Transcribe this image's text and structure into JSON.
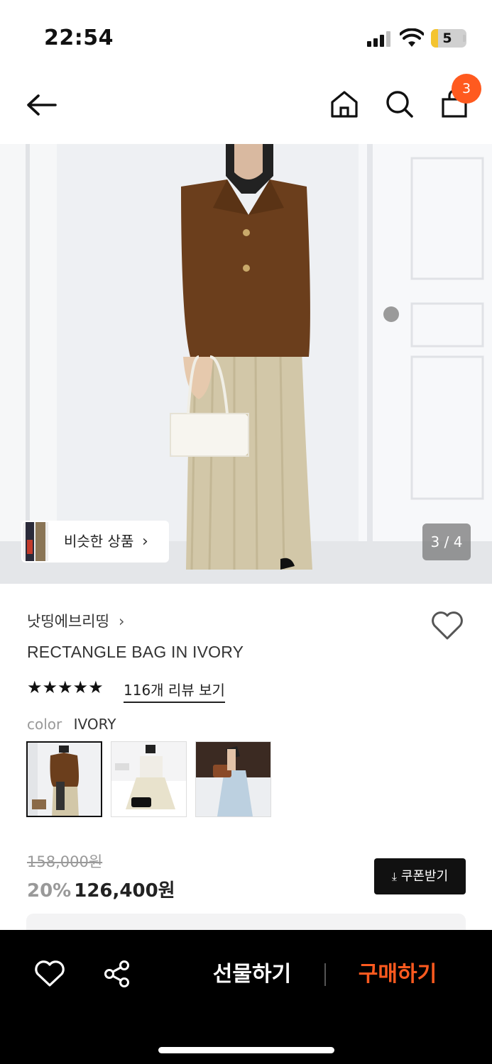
{
  "status_bar": {
    "time": "22:54",
    "battery": "5"
  },
  "header": {
    "cart_count": "3"
  },
  "hero": {
    "similar_label": "비슷한 상품",
    "similar_chevron": "›",
    "counter": "3 / 4"
  },
  "product": {
    "brand": "낫띵에브리띵",
    "brand_chevron": "›",
    "title": "RECTANGLE BAG IN IVORY",
    "rating": 5,
    "stars": "★★★★★",
    "review_link": "116개 리뷰 보기",
    "color_label": "color",
    "color_value": "IVORY",
    "swatches": [
      {
        "name": "swatch-ivory",
        "selected": true
      },
      {
        "name": "swatch-black",
        "selected": false
      },
      {
        "name": "swatch-brown",
        "selected": false
      }
    ]
  },
  "price": {
    "original": "158,000원",
    "discount": "20%",
    "sale": "126,400원",
    "coupon_label": "쿠폰받기",
    "coupon_icon": "download-icon"
  },
  "bottom_bar": {
    "gift_label": "선물하기",
    "buy_label": "구매하기",
    "buy_color": "#ff5a1f"
  },
  "icons": [
    "back-arrow-icon",
    "home-icon",
    "search-icon",
    "shopping-bag-icon",
    "heart-icon",
    "share-icon",
    "chevron-right-icon",
    "star-icon"
  ],
  "colors": {
    "accent": "#ff5a1f",
    "bottom_bar": "#000000",
    "coupon_bg": "#111111"
  }
}
